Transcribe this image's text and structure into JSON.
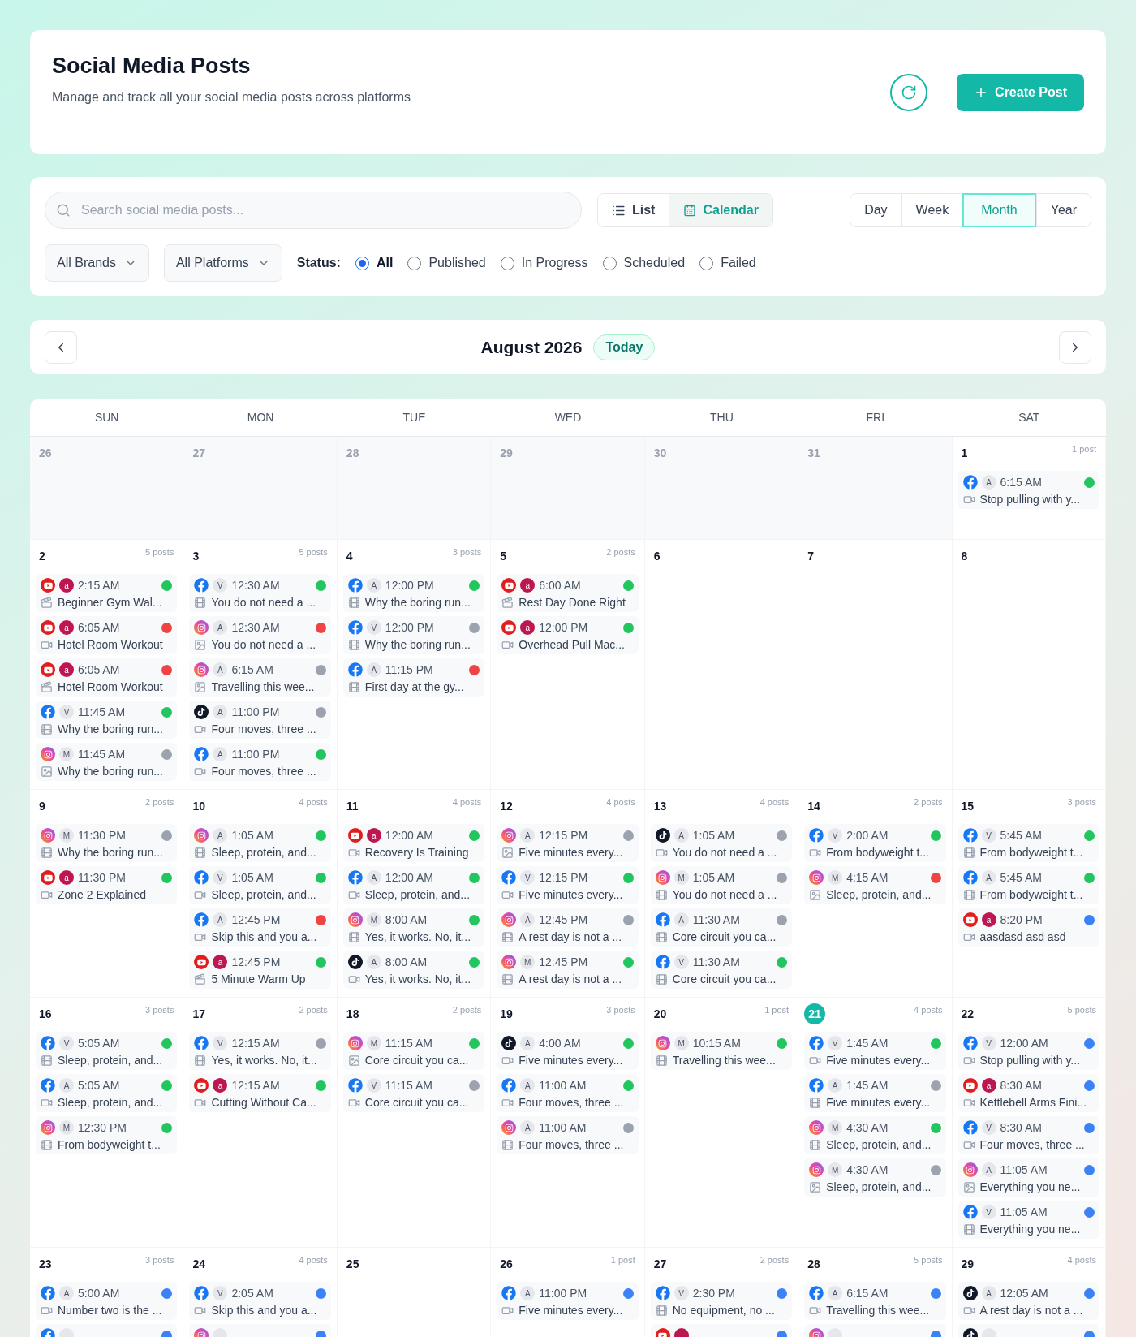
{
  "header": {
    "title": "Social Media Posts",
    "subtitle": "Manage and track all your social media posts across platforms",
    "create_button": "Create Post"
  },
  "search": {
    "placeholder": "Search social media posts..."
  },
  "view_modes": [
    {
      "label": "List",
      "kind": "list",
      "selected": false
    },
    {
      "label": "Calendar",
      "kind": "calendar",
      "selected": true
    }
  ],
  "ranges": [
    {
      "label": "Day",
      "selected": false
    },
    {
      "label": "Week",
      "selected": false
    },
    {
      "label": "Month",
      "selected": true
    },
    {
      "label": "Year",
      "selected": false
    }
  ],
  "filters": [
    "All Brands",
    "All Platforms"
  ],
  "status_label": "Status:",
  "statuses": [
    {
      "label": "All",
      "selected": true
    },
    {
      "label": "Published",
      "selected": false
    },
    {
      "label": "In Progress",
      "selected": false
    },
    {
      "label": "Scheduled",
      "selected": false
    },
    {
      "label": "Failed",
      "selected": false
    }
  ],
  "month": {
    "title": "August 2026",
    "today_button": "Today"
  },
  "weekdays": [
    "SUN",
    "MON",
    "TUE",
    "WED",
    "THU",
    "FRI",
    "SAT"
  ],
  "weeks": [
    {
      "days": [
        {
          "date": "26",
          "outside": true,
          "today": false
        },
        {
          "date": "27",
          "outside": true,
          "today": false
        },
        {
          "date": "28",
          "outside": true,
          "today": false
        },
        {
          "date": "29",
          "outside": true,
          "today": false
        },
        {
          "date": "30",
          "outside": true,
          "today": false
        },
        {
          "date": "31",
          "outside": true,
          "today": false
        },
        {
          "date": "1",
          "outside": false,
          "today": false,
          "count": "1 post",
          "posts": [
            {
              "platform": {
                "kind": "facebook"
              },
              "account": "A",
              "time": "6:15 AM",
              "color": "#22c55e",
              "media": {
                "kind": "video"
              },
              "title": "Stop pulling with y..."
            }
          ]
        }
      ]
    },
    {
      "days": [
        {
          "date": "2",
          "outside": false,
          "today": false,
          "count": "5 posts",
          "posts": [
            {
              "platform": {
                "kind": "youtube"
              },
              "account": "a",
              "time": "2:15 AM",
              "color": "#22c55e",
              "media": {
                "kind": "clapper"
              },
              "title": "Beginner Gym Wal..."
            },
            {
              "platform": {
                "kind": "youtube"
              },
              "account": "a",
              "time": "6:05 AM",
              "color": "#ef4444",
              "media": {
                "kind": "video"
              },
              "title": "Hotel Room Workout"
            },
            {
              "platform": {
                "kind": "youtube"
              },
              "account": "a",
              "time": "6:05 AM",
              "color": "#ef4444",
              "media": {
                "kind": "clapper"
              },
              "title": "Hotel Room Workout"
            },
            {
              "platform": {
                "kind": "facebook"
              },
              "account": "V",
              "time": "11:45 AM",
              "color": "#22c55e",
              "media": {
                "kind": "film"
              },
              "title": "Why the boring run..."
            },
            {
              "platform": {
                "kind": "instagram"
              },
              "account": "M",
              "time": "11:45 AM",
              "color": "#9ca3af",
              "media": {
                "kind": "image"
              },
              "title": "Why the boring run..."
            }
          ]
        },
        {
          "date": "3",
          "outside": false,
          "today": false,
          "count": "5 posts",
          "posts": [
            {
              "platform": {
                "kind": "facebook"
              },
              "account": "V",
              "time": "12:30 AM",
              "color": "#22c55e",
              "media": {
                "kind": "film"
              },
              "title": "You do not need a ..."
            },
            {
              "platform": {
                "kind": "instagram"
              },
              "account": "A",
              "time": "12:30 AM",
              "color": "#ef4444",
              "media": {
                "kind": "image"
              },
              "title": "You do not need a ..."
            },
            {
              "platform": {
                "kind": "instagram"
              },
              "account": "A",
              "time": "6:15 AM",
              "color": "#9ca3af",
              "media": {
                "kind": "image"
              },
              "title": "Travelling this wee..."
            },
            {
              "platform": {
                "kind": "tiktok"
              },
              "account": "A",
              "time": "11:00 PM",
              "color": "#9ca3af",
              "media": {
                "kind": "video"
              },
              "title": "Four moves, three ..."
            },
            {
              "platform": {
                "kind": "facebook"
              },
              "account": "A",
              "time": "11:00 PM",
              "color": "#22c55e",
              "media": {
                "kind": "video"
              },
              "title": "Four moves, three ..."
            }
          ]
        },
        {
          "date": "4",
          "outside": false,
          "today": false,
          "count": "3 posts",
          "posts": [
            {
              "platform": {
                "kind": "facebook"
              },
              "account": "A",
              "time": "12:00 PM",
              "color": "#22c55e",
              "media": {
                "kind": "film"
              },
              "title": "Why the boring run..."
            },
            {
              "platform": {
                "kind": "facebook"
              },
              "account": "V",
              "time": "12:00 PM",
              "color": "#9ca3af",
              "media": {
                "kind": "film"
              },
              "title": "Why the boring run..."
            },
            {
              "platform": {
                "kind": "facebook"
              },
              "account": "A",
              "time": "11:15 PM",
              "color": "#ef4444",
              "media": {
                "kind": "film"
              },
              "title": "First day at the gy..."
            }
          ]
        },
        {
          "date": "5",
          "outside": false,
          "today": false,
          "count": "2 posts",
          "posts": [
            {
              "platform": {
                "kind": "youtube"
              },
              "account": "a",
              "time": "6:00 AM",
              "color": "#22c55e",
              "media": {
                "kind": "clapper"
              },
              "title": "Rest Day Done Right"
            },
            {
              "platform": {
                "kind": "youtube"
              },
              "account": "a",
              "time": "12:00 PM",
              "color": "#22c55e",
              "media": {
                "kind": "video"
              },
              "title": "Overhead Pull Mac..."
            }
          ]
        },
        {
          "date": "6",
          "outside": false,
          "today": false
        },
        {
          "date": "7",
          "outside": false,
          "today": false
        },
        {
          "date": "8",
          "outside": false,
          "today": false
        }
      ]
    },
    {
      "days": [
        {
          "date": "9",
          "outside": false,
          "today": false,
          "count": "2 posts",
          "posts": [
            {
              "platform": {
                "kind": "instagram"
              },
              "account": "M",
              "time": "11:30 PM",
              "color": "#9ca3af",
              "media": {
                "kind": "film"
              },
              "title": "Why the boring run..."
            },
            {
              "platform": {
                "kind": "youtube"
              },
              "account": "a",
              "time": "11:30 PM",
              "color": "#22c55e",
              "media": {
                "kind": "video"
              },
              "title": "Zone 2 Explained"
            }
          ]
        },
        {
          "date": "10",
          "outside": false,
          "today": false,
          "count": "4 posts",
          "posts": [
            {
              "platform": {
                "kind": "instagram"
              },
              "account": "A",
              "time": "1:05 AM",
              "color": "#22c55e",
              "media": {
                "kind": "film"
              },
              "title": "Sleep, protein, and..."
            },
            {
              "platform": {
                "kind": "facebook"
              },
              "account": "V",
              "time": "1:05 AM",
              "color": "#22c55e",
              "media": {
                "kind": "video"
              },
              "title": "Sleep, protein, and..."
            },
            {
              "platform": {
                "kind": "facebook"
              },
              "account": "A",
              "time": "12:45 PM",
              "color": "#ef4444",
              "media": {
                "kind": "video"
              },
              "title": "Skip this and you a..."
            },
            {
              "platform": {
                "kind": "youtube"
              },
              "account": "a",
              "time": "12:45 PM",
              "color": "#22c55e",
              "media": {
                "kind": "clapper"
              },
              "title": "5 Minute Warm Up"
            }
          ]
        },
        {
          "date": "11",
          "outside": false,
          "today": false,
          "count": "4 posts",
          "posts": [
            {
              "platform": {
                "kind": "youtube"
              },
              "account": "a",
              "time": "12:00 AM",
              "color": "#22c55e",
              "media": {
                "kind": "video"
              },
              "title": "Recovery Is Training"
            },
            {
              "platform": {
                "kind": "facebook"
              },
              "account": "A",
              "time": "12:00 AM",
              "color": "#22c55e",
              "media": {
                "kind": "video"
              },
              "title": "Sleep, protein, and..."
            },
            {
              "platform": {
                "kind": "instagram"
              },
              "account": "M",
              "time": "8:00 AM",
              "color": "#22c55e",
              "media": {
                "kind": "film"
              },
              "title": "Yes, it works. No, it..."
            },
            {
              "platform": {
                "kind": "tiktok"
              },
              "account": "A",
              "time": "8:00 AM",
              "color": "#22c55e",
              "media": {
                "kind": "video"
              },
              "title": "Yes, it works. No, it..."
            }
          ]
        },
        {
          "date": "12",
          "outside": false,
          "today": false,
          "count": "4 posts",
          "posts": [
            {
              "platform": {
                "kind": "instagram"
              },
              "account": "A",
              "time": "12:15 PM",
              "color": "#9ca3af",
              "media": {
                "kind": "image"
              },
              "title": "Five minutes every..."
            },
            {
              "platform": {
                "kind": "facebook"
              },
              "account": "V",
              "time": "12:15 PM",
              "color": "#22c55e",
              "media": {
                "kind": "video"
              },
              "title": "Five minutes every..."
            },
            {
              "platform": {
                "kind": "instagram"
              },
              "account": "A",
              "time": "12:45 PM",
              "color": "#9ca3af",
              "media": {
                "kind": "film"
              },
              "title": "A rest day is not a ..."
            },
            {
              "platform": {
                "kind": "instagram"
              },
              "account": "M",
              "time": "12:45 PM",
              "color": "#22c55e",
              "media": {
                "kind": "film"
              },
              "title": "A rest day is not a ..."
            }
          ]
        },
        {
          "date": "13",
          "outside": false,
          "today": false,
          "count": "4 posts",
          "posts": [
            {
              "platform": {
                "kind": "tiktok"
              },
              "account": "A",
              "time": "1:05 AM",
              "color": "#9ca3af",
              "media": {
                "kind": "video"
              },
              "title": "You do not need a ..."
            },
            {
              "platform": {
                "kind": "instagram"
              },
              "account": "M",
              "time": "1:05 AM",
              "color": "#9ca3af",
              "media": {
                "kind": "film"
              },
              "title": "You do not need a ..."
            },
            {
              "platform": {
                "kind": "facebook"
              },
              "account": "A",
              "time": "11:30 AM",
              "color": "#9ca3af",
              "media": {
                "kind": "film"
              },
              "title": "Core circuit you ca..."
            },
            {
              "platform": {
                "kind": "facebook"
              },
              "account": "V",
              "time": "11:30 AM",
              "color": "#22c55e",
              "media": {
                "kind": "film"
              },
              "title": "Core circuit you ca..."
            }
          ]
        },
        {
          "date": "14",
          "outside": false,
          "today": false,
          "count": "2 posts",
          "posts": [
            {
              "platform": {
                "kind": "facebook"
              },
              "account": "V",
              "time": "2:00 AM",
              "color": "#22c55e",
              "media": {
                "kind": "video"
              },
              "title": "From bodyweight t..."
            },
            {
              "platform": {
                "kind": "instagram"
              },
              "account": "M",
              "time": "4:15 AM",
              "color": "#ef4444",
              "media": {
                "kind": "image"
              },
              "title": "Sleep, protein, and..."
            }
          ]
        },
        {
          "date": "15",
          "outside": false,
          "today": false,
          "count": "3 posts",
          "posts": [
            {
              "platform": {
                "kind": "facebook"
              },
              "account": "V",
              "time": "5:45 AM",
              "color": "#22c55e",
              "media": {
                "kind": "film"
              },
              "title": "From bodyweight t..."
            },
            {
              "platform": {
                "kind": "facebook"
              },
              "account": "A",
              "time": "5:45 AM",
              "color": "#22c55e",
              "media": {
                "kind": "film"
              },
              "title": "From bodyweight t..."
            },
            {
              "platform": {
                "kind": "youtube"
              },
              "account": "a",
              "time": "8:20 PM",
              "color": "#3b82f6",
              "media": {
                "kind": "video"
              },
              "title": "aasdasd asd asd"
            }
          ]
        }
      ]
    },
    {
      "days": [
        {
          "date": "16",
          "outside": false,
          "today": false,
          "count": "3 posts",
          "posts": [
            {
              "platform": {
                "kind": "facebook"
              },
              "account": "V",
              "time": "5:05 AM",
              "color": "#22c55e",
              "media": {
                "kind": "film"
              },
              "title": "Sleep, protein, and..."
            },
            {
              "platform": {
                "kind": "facebook"
              },
              "account": "A",
              "time": "5:05 AM",
              "color": "#22c55e",
              "media": {
                "kind": "video"
              },
              "title": "Sleep, protein, and..."
            },
            {
              "platform": {
                "kind": "instagram"
              },
              "account": "M",
              "time": "12:30 PM",
              "color": "#22c55e",
              "media": {
                "kind": "film"
              },
              "title": "From bodyweight t..."
            }
          ]
        },
        {
          "date": "17",
          "outside": false,
          "today": false,
          "count": "2 posts",
          "posts": [
            {
              "platform": {
                "kind": "facebook"
              },
              "account": "V",
              "time": "12:15 AM",
              "color": "#9ca3af",
              "media": {
                "kind": "film"
              },
              "title": "Yes, it works. No, it..."
            },
            {
              "platform": {
                "kind": "youtube"
              },
              "account": "a",
              "time": "12:15 AM",
              "color": "#22c55e",
              "media": {
                "kind": "video"
              },
              "title": "Cutting Without Ca..."
            }
          ]
        },
        {
          "date": "18",
          "outside": false,
          "today": false,
          "count": "2 posts",
          "posts": [
            {
              "platform": {
                "kind": "instagram"
              },
              "account": "M",
              "time": "11:15 AM",
              "color": "#22c55e",
              "media": {
                "kind": "image"
              },
              "title": "Core circuit you ca..."
            },
            {
              "platform": {
                "kind": "facebook"
              },
              "account": "V",
              "time": "11:15 AM",
              "color": "#9ca3af",
              "media": {
                "kind": "video"
              },
              "title": "Core circuit you ca..."
            }
          ]
        },
        {
          "date": "19",
          "outside": false,
          "today": false,
          "count": "3 posts",
          "posts": [
            {
              "platform": {
                "kind": "tiktok"
              },
              "account": "A",
              "time": "4:00 AM",
              "color": "#22c55e",
              "media": {
                "kind": "video"
              },
              "title": "Five minutes every..."
            },
            {
              "platform": {
                "kind": "facebook"
              },
              "account": "A",
              "time": "11:00 AM",
              "color": "#22c55e",
              "media": {
                "kind": "video"
              },
              "title": "Four moves, three ..."
            },
            {
              "platform": {
                "kind": "instagram"
              },
              "account": "A",
              "time": "11:00 AM",
              "color": "#9ca3af",
              "media": {
                "kind": "film"
              },
              "title": "Four moves, three ..."
            }
          ]
        },
        {
          "date": "20",
          "outside": false,
          "today": false,
          "count": "1 post",
          "posts": [
            {
              "platform": {
                "kind": "instagram"
              },
              "account": "M",
              "time": "10:15 AM",
              "color": "#22c55e",
              "media": {
                "kind": "film"
              },
              "title": "Travelling this wee..."
            }
          ]
        },
        {
          "date": "21",
          "outside": false,
          "today": true,
          "count": "4 posts",
          "posts": [
            {
              "platform": {
                "kind": "facebook"
              },
              "account": "V",
              "time": "1:45 AM",
              "color": "#22c55e",
              "media": {
                "kind": "video"
              },
              "title": "Five minutes every..."
            },
            {
              "platform": {
                "kind": "facebook"
              },
              "account": "A",
              "time": "1:45 AM",
              "color": "#9ca3af",
              "media": {
                "kind": "film"
              },
              "title": "Five minutes every..."
            },
            {
              "platform": {
                "kind": "instagram"
              },
              "account": "M",
              "time": "4:30 AM",
              "color": "#22c55e",
              "media": {
                "kind": "film"
              },
              "title": "Sleep, protein, and..."
            },
            {
              "platform": {
                "kind": "instagram"
              },
              "account": "M",
              "time": "4:30 AM",
              "color": "#9ca3af",
              "media": {
                "kind": "image"
              },
              "title": "Sleep, protein, and..."
            }
          ]
        },
        {
          "date": "22",
          "outside": false,
          "today": false,
          "count": "5 posts",
          "posts": [
            {
              "platform": {
                "kind": "facebook"
              },
              "account": "V",
              "time": "12:00 AM",
              "color": "#3b82f6",
              "media": {
                "kind": "video"
              },
              "title": "Stop pulling with y..."
            },
            {
              "platform": {
                "kind": "youtube"
              },
              "account": "a",
              "time": "8:30 AM",
              "color": "#3b82f6",
              "media": {
                "kind": "video"
              },
              "title": "Kettlebell Arms Fini..."
            },
            {
              "platform": {
                "kind": "facebook"
              },
              "account": "V",
              "time": "8:30 AM",
              "color": "#3b82f6",
              "media": {
                "kind": "video"
              },
              "title": "Four moves, three ..."
            },
            {
              "platform": {
                "kind": "instagram"
              },
              "account": "A",
              "time": "11:05 AM",
              "color": "#3b82f6",
              "media": {
                "kind": "image"
              },
              "title": "Everything you ne..."
            },
            {
              "platform": {
                "kind": "facebook"
              },
              "account": "V",
              "time": "11:05 AM",
              "color": "#3b82f6",
              "media": {
                "kind": "film"
              },
              "title": "Everything you ne..."
            }
          ]
        }
      ]
    },
    {
      "days": [
        {
          "date": "23",
          "outside": false,
          "today": false,
          "count": "3 posts",
          "posts": [
            {
              "platform": {
                "kind": "facebook"
              },
              "account": "A",
              "time": "5:00 AM",
              "color": "#3b82f6",
              "media": {
                "kind": "video"
              },
              "title": "Number two is the ..."
            },
            {
              "platform": {
                "kind": "facebook"
              },
              "color": "#3b82f6"
            }
          ]
        },
        {
          "date": "24",
          "outside": false,
          "today": false,
          "count": "4 posts",
          "posts": [
            {
              "platform": {
                "kind": "facebook"
              },
              "account": "V",
              "time": "2:05 AM",
              "color": "#3b82f6",
              "media": {
                "kind": "video"
              },
              "title": "Skip this and you a..."
            },
            {
              "platform": {
                "kind": "instagram"
              },
              "color": "#3b82f6"
            }
          ]
        },
        {
          "date": "25",
          "outside": false,
          "today": false
        },
        {
          "date": "26",
          "outside": false,
          "today": false,
          "count": "1 post",
          "posts": [
            {
              "platform": {
                "kind": "facebook"
              },
              "account": "A",
              "time": "11:00 PM",
              "color": "#3b82f6",
              "media": {
                "kind": "video"
              },
              "title": "Five minutes every..."
            }
          ]
        },
        {
          "date": "27",
          "outside": false,
          "today": false,
          "count": "2 posts",
          "posts": [
            {
              "platform": {
                "kind": "facebook"
              },
              "account": "V",
              "time": "2:30 PM",
              "color": "#3b82f6",
              "media": {
                "kind": "film"
              },
              "title": "No equipment, no ..."
            },
            {
              "platform": {
                "kind": "youtube"
              },
              "color": "#3b82f6"
            }
          ]
        },
        {
          "date": "28",
          "outside": false,
          "today": false,
          "count": "5 posts",
          "posts": [
            {
              "platform": {
                "kind": "facebook"
              },
              "account": "A",
              "time": "6:15 AM",
              "color": "#3b82f6",
              "media": {
                "kind": "video"
              },
              "title": "Travelling this wee..."
            },
            {
              "platform": {
                "kind": "instagram"
              },
              "color": "#3b82f6"
            }
          ]
        },
        {
          "date": "29",
          "outside": false,
          "today": false,
          "count": "4 posts",
          "posts": [
            {
              "platform": {
                "kind": "tiktok"
              },
              "account": "A",
              "time": "12:05 AM",
              "color": "#3b82f6",
              "media": {
                "kind": "video"
              },
              "title": "A rest day is not a ..."
            },
            {
              "platform": {
                "kind": "tiktok"
              },
              "color": "#3b82f6"
            }
          ]
        }
      ]
    }
  ]
}
